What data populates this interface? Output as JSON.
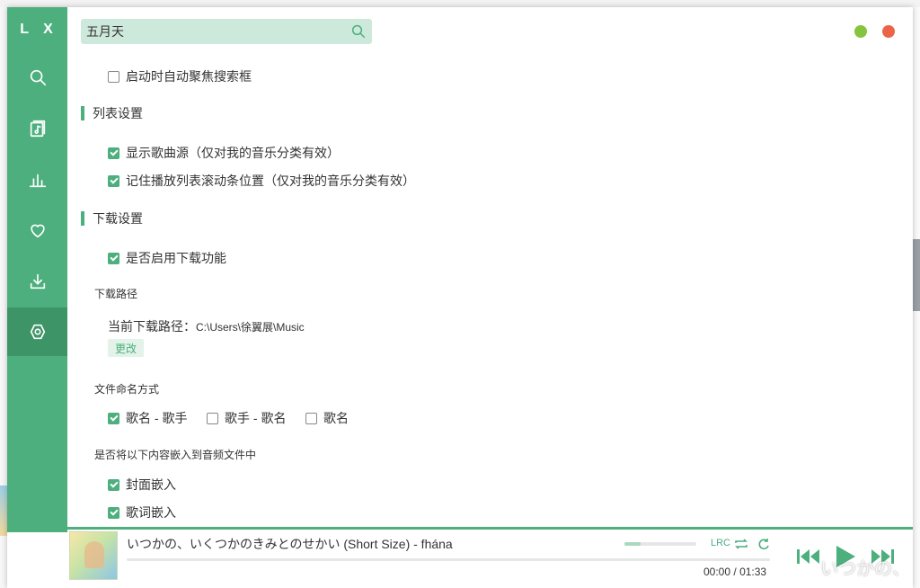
{
  "app": {
    "logo": "L X"
  },
  "search": {
    "value": "五月天"
  },
  "settings": {
    "auto_focus_search": {
      "label": "启动时自动聚焦搜索框",
      "checked": false
    },
    "list_section": {
      "title": "列表设置",
      "show_source": {
        "label": "显示歌曲源（仅对我的音乐分类有效）",
        "checked": true
      },
      "remember_scroll": {
        "label": "记住播放列表滚动条位置（仅对我的音乐分类有效）",
        "checked": true
      }
    },
    "download_section": {
      "title": "下载设置",
      "enable": {
        "label": "是否启用下载功能",
        "checked": true
      },
      "path_title": "下载路径",
      "path_label": "当前下载路径：",
      "path_value": "C:\\Users\\徐翼展\\Music",
      "change_button": "更改",
      "naming_title": "文件命名方式",
      "naming_options": [
        {
          "label": "歌名 - 歌手",
          "checked": true
        },
        {
          "label": "歌手 - 歌名",
          "checked": false
        },
        {
          "label": "歌名",
          "checked": false
        }
      ],
      "embed_title": "是否将以下内容嵌入到音频文件中",
      "embed_cover": {
        "label": "封面嵌入",
        "checked": true
      },
      "embed_lyric": {
        "label": "歌词嵌入",
        "checked": true
      }
    }
  },
  "player": {
    "title": "いつかの、いくつかのきみとのせかい (Short Size) - fhána",
    "current_time": "00:00",
    "separator": "/",
    "duration": "01:33",
    "lrc_label": "LRC",
    "progress": 0,
    "volume": 0.22,
    "lyric_overlay": "いつかの、"
  },
  "colors": {
    "accent": "#4caf7d",
    "accent_dark": "#3d9467",
    "search_bg": "#cde9db",
    "min_btn": "#85c43f",
    "close_btn": "#ec6448"
  },
  "icons": [
    "search-icon",
    "music-list-icon",
    "chart-icon",
    "heart-icon",
    "download-icon",
    "settings-icon",
    "repeat-icon",
    "loop-icon",
    "prev-icon",
    "play-icon",
    "next-icon"
  ]
}
